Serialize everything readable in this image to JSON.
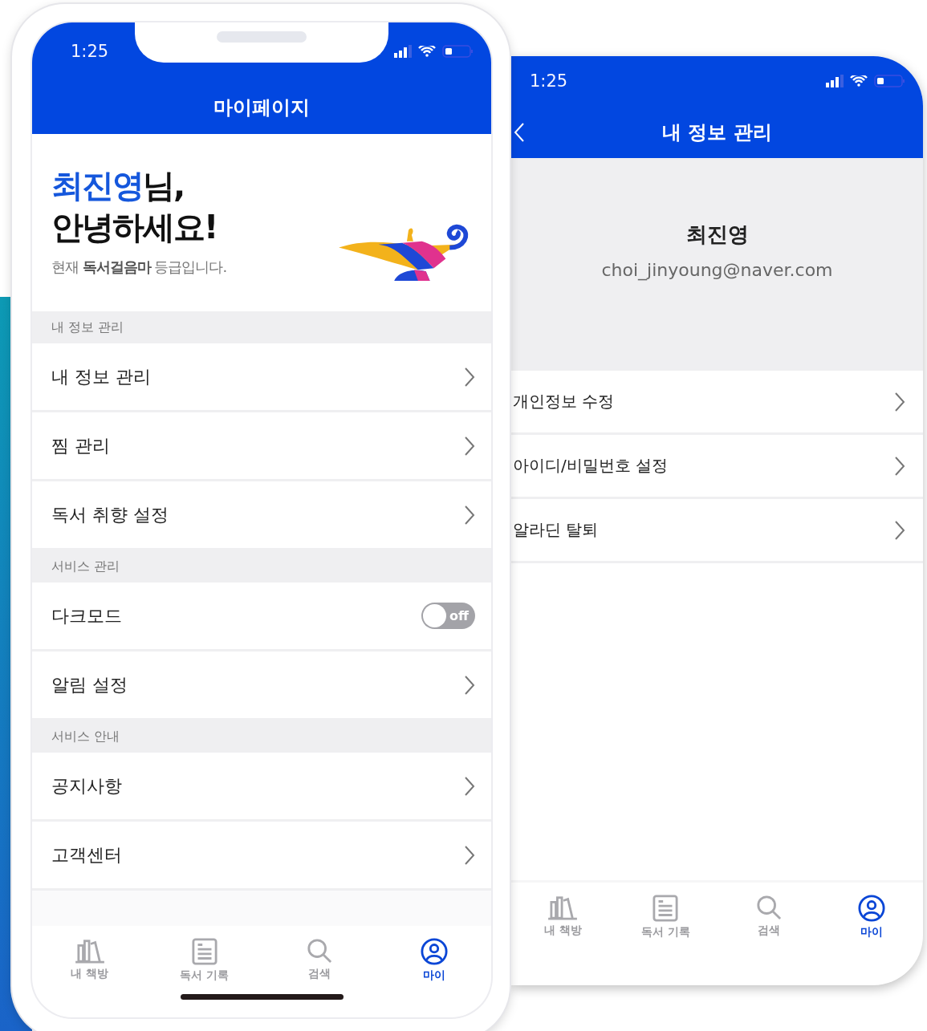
{
  "my_page": {
    "status_time": "1:25",
    "title": "마이페이지",
    "greeting": {
      "name": "최진영",
      "name_suffix": "님,",
      "line_2": "안녕하세요!",
      "grade": "현재 **독서걸음마** 등급입니다."
    },
    "sections": [
      {
        "header": "내 정보 관리",
        "items": [
          {
            "kind": "link",
            "label": "내 정보 관리"
          },
          {
            "kind": "link",
            "label": "찜 관리"
          },
          {
            "kind": "link",
            "label": "독서 취향 설정"
          }
        ]
      },
      {
        "header": "서비스 관리",
        "items": [
          {
            "kind": "toggle",
            "label": "다크모드",
            "on": false,
            "toggle_text": "off"
          },
          {
            "kind": "link",
            "label": "알림 설정"
          }
        ]
      },
      {
        "header": "서비스 안내",
        "items": [
          {
            "kind": "link",
            "label": "공지사항"
          },
          {
            "kind": "link",
            "label": "고객센터"
          }
        ]
      }
    ],
    "tabs": [
      {
        "label": "내 책방",
        "selected": false
      },
      {
        "label": "독서 기록",
        "selected": false
      },
      {
        "label": "검색",
        "selected": false
      },
      {
        "label": "마이",
        "selected": true
      }
    ]
  },
  "profile_page": {
    "status_time": "1:25",
    "title": "내 정보 관리",
    "name": "최진영",
    "email": "choi_jinyoung@naver.com",
    "items": [
      {
        "label": "개인정보 수정"
      },
      {
        "label": "아이디/비밀번호 설정"
      },
      {
        "label": "알라딘 탈퇴"
      }
    ],
    "tabs": [
      {
        "label": "내 책방",
        "selected": false
      },
      {
        "label": "독서 기록",
        "selected": false
      },
      {
        "label": "검색",
        "selected": false
      },
      {
        "label": "마이",
        "selected": true
      }
    ]
  }
}
